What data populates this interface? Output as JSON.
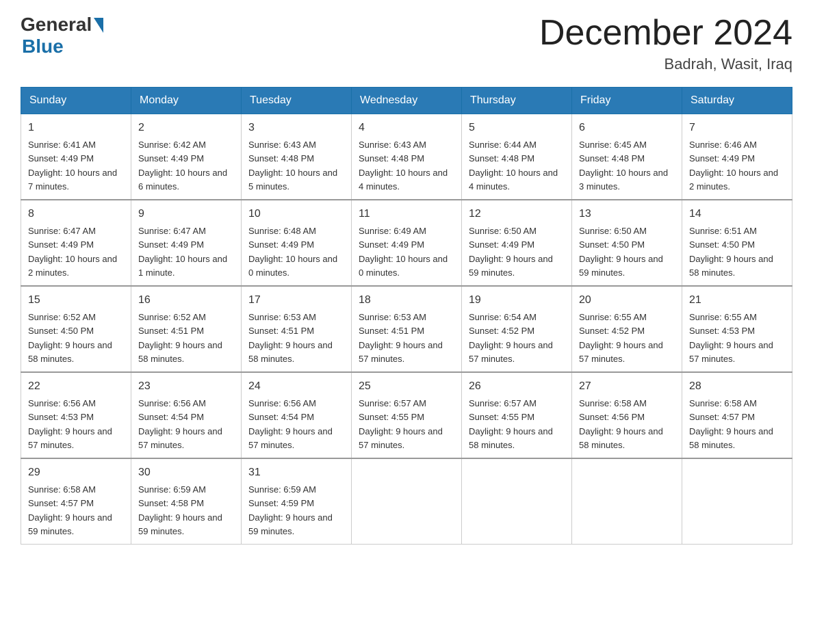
{
  "header": {
    "logo_general": "General",
    "logo_blue": "Blue",
    "month_title": "December 2024",
    "location": "Badrah, Wasit, Iraq"
  },
  "weekdays": [
    "Sunday",
    "Monday",
    "Tuesday",
    "Wednesday",
    "Thursday",
    "Friday",
    "Saturday"
  ],
  "weeks": [
    [
      {
        "day": "1",
        "sunrise": "Sunrise: 6:41 AM",
        "sunset": "Sunset: 4:49 PM",
        "daylight": "Daylight: 10 hours and 7 minutes."
      },
      {
        "day": "2",
        "sunrise": "Sunrise: 6:42 AM",
        "sunset": "Sunset: 4:49 PM",
        "daylight": "Daylight: 10 hours and 6 minutes."
      },
      {
        "day": "3",
        "sunrise": "Sunrise: 6:43 AM",
        "sunset": "Sunset: 4:48 PM",
        "daylight": "Daylight: 10 hours and 5 minutes."
      },
      {
        "day": "4",
        "sunrise": "Sunrise: 6:43 AM",
        "sunset": "Sunset: 4:48 PM",
        "daylight": "Daylight: 10 hours and 4 minutes."
      },
      {
        "day": "5",
        "sunrise": "Sunrise: 6:44 AM",
        "sunset": "Sunset: 4:48 PM",
        "daylight": "Daylight: 10 hours and 4 minutes."
      },
      {
        "day": "6",
        "sunrise": "Sunrise: 6:45 AM",
        "sunset": "Sunset: 4:48 PM",
        "daylight": "Daylight: 10 hours and 3 minutes."
      },
      {
        "day": "7",
        "sunrise": "Sunrise: 6:46 AM",
        "sunset": "Sunset: 4:49 PM",
        "daylight": "Daylight: 10 hours and 2 minutes."
      }
    ],
    [
      {
        "day": "8",
        "sunrise": "Sunrise: 6:47 AM",
        "sunset": "Sunset: 4:49 PM",
        "daylight": "Daylight: 10 hours and 2 minutes."
      },
      {
        "day": "9",
        "sunrise": "Sunrise: 6:47 AM",
        "sunset": "Sunset: 4:49 PM",
        "daylight": "Daylight: 10 hours and 1 minute."
      },
      {
        "day": "10",
        "sunrise": "Sunrise: 6:48 AM",
        "sunset": "Sunset: 4:49 PM",
        "daylight": "Daylight: 10 hours and 0 minutes."
      },
      {
        "day": "11",
        "sunrise": "Sunrise: 6:49 AM",
        "sunset": "Sunset: 4:49 PM",
        "daylight": "Daylight: 10 hours and 0 minutes."
      },
      {
        "day": "12",
        "sunrise": "Sunrise: 6:50 AM",
        "sunset": "Sunset: 4:49 PM",
        "daylight": "Daylight: 9 hours and 59 minutes."
      },
      {
        "day": "13",
        "sunrise": "Sunrise: 6:50 AM",
        "sunset": "Sunset: 4:50 PM",
        "daylight": "Daylight: 9 hours and 59 minutes."
      },
      {
        "day": "14",
        "sunrise": "Sunrise: 6:51 AM",
        "sunset": "Sunset: 4:50 PM",
        "daylight": "Daylight: 9 hours and 58 minutes."
      }
    ],
    [
      {
        "day": "15",
        "sunrise": "Sunrise: 6:52 AM",
        "sunset": "Sunset: 4:50 PM",
        "daylight": "Daylight: 9 hours and 58 minutes."
      },
      {
        "day": "16",
        "sunrise": "Sunrise: 6:52 AM",
        "sunset": "Sunset: 4:51 PM",
        "daylight": "Daylight: 9 hours and 58 minutes."
      },
      {
        "day": "17",
        "sunrise": "Sunrise: 6:53 AM",
        "sunset": "Sunset: 4:51 PM",
        "daylight": "Daylight: 9 hours and 58 minutes."
      },
      {
        "day": "18",
        "sunrise": "Sunrise: 6:53 AM",
        "sunset": "Sunset: 4:51 PM",
        "daylight": "Daylight: 9 hours and 57 minutes."
      },
      {
        "day": "19",
        "sunrise": "Sunrise: 6:54 AM",
        "sunset": "Sunset: 4:52 PM",
        "daylight": "Daylight: 9 hours and 57 minutes."
      },
      {
        "day": "20",
        "sunrise": "Sunrise: 6:55 AM",
        "sunset": "Sunset: 4:52 PM",
        "daylight": "Daylight: 9 hours and 57 minutes."
      },
      {
        "day": "21",
        "sunrise": "Sunrise: 6:55 AM",
        "sunset": "Sunset: 4:53 PM",
        "daylight": "Daylight: 9 hours and 57 minutes."
      }
    ],
    [
      {
        "day": "22",
        "sunrise": "Sunrise: 6:56 AM",
        "sunset": "Sunset: 4:53 PM",
        "daylight": "Daylight: 9 hours and 57 minutes."
      },
      {
        "day": "23",
        "sunrise": "Sunrise: 6:56 AM",
        "sunset": "Sunset: 4:54 PM",
        "daylight": "Daylight: 9 hours and 57 minutes."
      },
      {
        "day": "24",
        "sunrise": "Sunrise: 6:56 AM",
        "sunset": "Sunset: 4:54 PM",
        "daylight": "Daylight: 9 hours and 57 minutes."
      },
      {
        "day": "25",
        "sunrise": "Sunrise: 6:57 AM",
        "sunset": "Sunset: 4:55 PM",
        "daylight": "Daylight: 9 hours and 57 minutes."
      },
      {
        "day": "26",
        "sunrise": "Sunrise: 6:57 AM",
        "sunset": "Sunset: 4:55 PM",
        "daylight": "Daylight: 9 hours and 58 minutes."
      },
      {
        "day": "27",
        "sunrise": "Sunrise: 6:58 AM",
        "sunset": "Sunset: 4:56 PM",
        "daylight": "Daylight: 9 hours and 58 minutes."
      },
      {
        "day": "28",
        "sunrise": "Sunrise: 6:58 AM",
        "sunset": "Sunset: 4:57 PM",
        "daylight": "Daylight: 9 hours and 58 minutes."
      }
    ],
    [
      {
        "day": "29",
        "sunrise": "Sunrise: 6:58 AM",
        "sunset": "Sunset: 4:57 PM",
        "daylight": "Daylight: 9 hours and 59 minutes."
      },
      {
        "day": "30",
        "sunrise": "Sunrise: 6:59 AM",
        "sunset": "Sunset: 4:58 PM",
        "daylight": "Daylight: 9 hours and 59 minutes."
      },
      {
        "day": "31",
        "sunrise": "Sunrise: 6:59 AM",
        "sunset": "Sunset: 4:59 PM",
        "daylight": "Daylight: 9 hours and 59 minutes."
      },
      null,
      null,
      null,
      null
    ]
  ]
}
